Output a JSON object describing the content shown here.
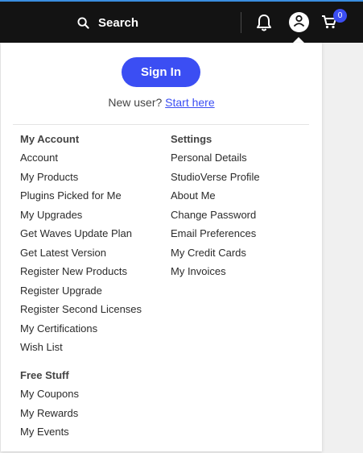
{
  "header": {
    "search_label": "Search",
    "cart_count": "0"
  },
  "account": {
    "signin_label": "Sign In",
    "new_user_text": "New user?",
    "start_here_label": "Start here"
  },
  "menu": {
    "my_account": {
      "heading": "My Account",
      "items": [
        "Account",
        "My Products",
        "Plugins Picked for Me",
        "My Upgrades",
        "Get Waves Update Plan",
        "Get Latest Version",
        "Register New Products",
        "Register Upgrade",
        "Register Second Licenses",
        "My Certifications",
        "Wish List"
      ]
    },
    "settings": {
      "heading": "Settings",
      "items": [
        "Personal Details",
        "StudioVerse Profile",
        "About Me",
        "Change Password",
        "Email Preferences",
        "My Credit Cards",
        "My Invoices"
      ]
    },
    "free_stuff": {
      "heading": "Free Stuff",
      "items": [
        "My Coupons",
        "My Rewards",
        "My Events"
      ]
    }
  },
  "colors": {
    "accent": "#3b4ef3",
    "topbar": "#131313",
    "panel": "#ffffff"
  }
}
